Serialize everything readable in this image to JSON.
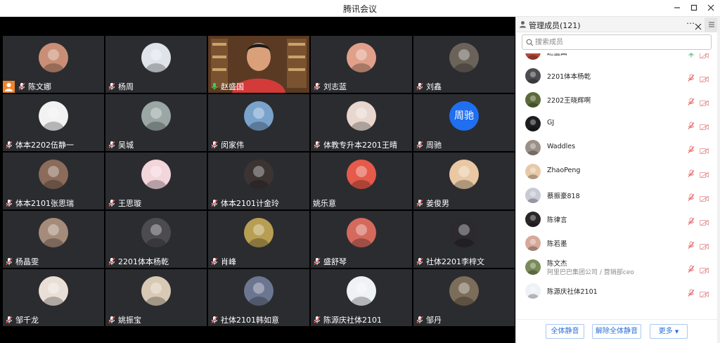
{
  "window": {
    "title": "腾讯会议",
    "min_icon": "minimize-icon",
    "max_icon": "maximize-icon",
    "close_icon": "close-icon"
  },
  "colors": {
    "accent": "#1f6ff0",
    "active_speaker": "#3aa94a",
    "host_badge": "#f0842b",
    "tile_bg": "#2b2c30",
    "muted": "#e85c5c"
  },
  "grid": {
    "tiles": [
      {
        "name": "陈文娜",
        "avatar": "photo",
        "tone": "#c98f76",
        "host": true,
        "mic": "muted"
      },
      {
        "name": "杨周",
        "avatar": "photo",
        "tone": "#dfe3ea",
        "mic": "muted"
      },
      {
        "name": "赵盛国",
        "avatar": "video",
        "tone": "#d33a3a",
        "active": true,
        "mic": "speaking"
      },
      {
        "name": "刘志蓝",
        "avatar": "photo",
        "tone": "#e0a08a",
        "mic": "muted"
      },
      {
        "name": "刘鑫",
        "avatar": "photo",
        "tone": "#6b625a",
        "mic": "muted"
      },
      {
        "name": "体本2202伍静一",
        "avatar": "photo",
        "tone": "#f2f2f2",
        "mic": "muted"
      },
      {
        "name": "吴城",
        "avatar": "photo",
        "tone": "#9aa7a4",
        "mic": "muted"
      },
      {
        "name": "闵家伟",
        "avatar": "photo",
        "tone": "#7aa3cc",
        "mic": "muted"
      },
      {
        "name": "体教专升本2201王晴",
        "avatar": "photo",
        "tone": "#e8d7cf",
        "mic": "muted"
      },
      {
        "name": "周驰",
        "avatar": "text",
        "initials": "周驰",
        "mic": "muted"
      },
      {
        "name": "体本2101张思瑞",
        "avatar": "photo",
        "tone": "#8b6b5a",
        "mic": "muted"
      },
      {
        "name": "王思璇",
        "avatar": "photo",
        "tone": "#f3d6dc",
        "mic": "muted"
      },
      {
        "name": "体本2101计金玲",
        "avatar": "photo",
        "tone": "#3b3433",
        "mic": "muted"
      },
      {
        "name": "姚乐意",
        "avatar": "photo",
        "tone": "#e55a4a",
        "mic": "none"
      },
      {
        "name": "姜俊男",
        "avatar": "photo",
        "tone": "#e9c8a3",
        "mic": "muted"
      },
      {
        "name": "杨晶雯",
        "avatar": "photo",
        "tone": "#a58b7a",
        "mic": "muted"
      },
      {
        "name": "2201体本杨乾",
        "avatar": "photo",
        "tone": "#4c4c50",
        "mic": "muted"
      },
      {
        "name": "肖峰",
        "avatar": "photo",
        "tone": "#b79e52",
        "mic": "muted"
      },
      {
        "name": "盛舒琴",
        "avatar": "photo",
        "tone": "#d56a5c",
        "mic": "muted"
      },
      {
        "name": "社体2201李梓文",
        "avatar": "photo",
        "tone": "#2c2a2d",
        "mic": "muted"
      },
      {
        "name": "邹千龙",
        "avatar": "photo",
        "tone": "#eadfd7",
        "mic": "muted"
      },
      {
        "name": "姚振宝",
        "avatar": "photo",
        "tone": "#d8c9b4",
        "mic": "muted"
      },
      {
        "name": "社体2101韩如意",
        "avatar": "photo",
        "tone": "#6c7690",
        "mic": "muted"
      },
      {
        "name": "陈源庆社体2101",
        "avatar": "photo",
        "tone": "#eef2f6",
        "mic": "muted"
      },
      {
        "name": "邹丹",
        "avatar": "photo",
        "tone": "#7c6d5a",
        "mic": "muted"
      }
    ]
  },
  "sidebar": {
    "title": "管理成员(121)",
    "more_icon": "ellipsis-icon",
    "search": {
      "placeholder": "搜索成员",
      "icon": "search-icon"
    },
    "members": [
      {
        "name": "赵盛国",
        "tone": "#b24a3a",
        "mic": "on",
        "cam": "off"
      },
      {
        "name": "2201体本杨乾",
        "tone": "#4c4c50",
        "mic": "muted",
        "cam": "off"
      },
      {
        "name": "2202王晓辉啊",
        "tone": "#5b6a3a",
        "mic": "muted",
        "cam": "off"
      },
      {
        "name": "GJ",
        "tone": "#1d1d1f",
        "mic": "muted",
        "cam": "off"
      },
      {
        "name": "Waddles",
        "tone": "#9b8f86",
        "mic": "muted",
        "cam": "off"
      },
      {
        "name": "ZhaoPeng",
        "tone": "#e7c9a8",
        "mic": "muted",
        "cam": "off"
      },
      {
        "name": "蔡振豪818",
        "tone": "#c8cad6",
        "mic": "muted",
        "cam": "off"
      },
      {
        "name": "陈律言",
        "tone": "#2a2628",
        "mic": "muted",
        "cam": "off"
      },
      {
        "name": "陈若墨",
        "tone": "#d6a999",
        "mic": "muted",
        "cam": "off"
      },
      {
        "name": "陈文杰",
        "sub": "阿里巴巴集团公司 / 营销部ceo",
        "tone": "#7a8b5a",
        "mic": "muted",
        "cam": "off"
      },
      {
        "name": "陈源庆社体2101",
        "tone": "#eef2f6",
        "mic": "muted",
        "cam": "off"
      }
    ],
    "footer": {
      "mute_all": "全体静音",
      "unmute_all": "解除全体静音",
      "more": "更多"
    }
  }
}
